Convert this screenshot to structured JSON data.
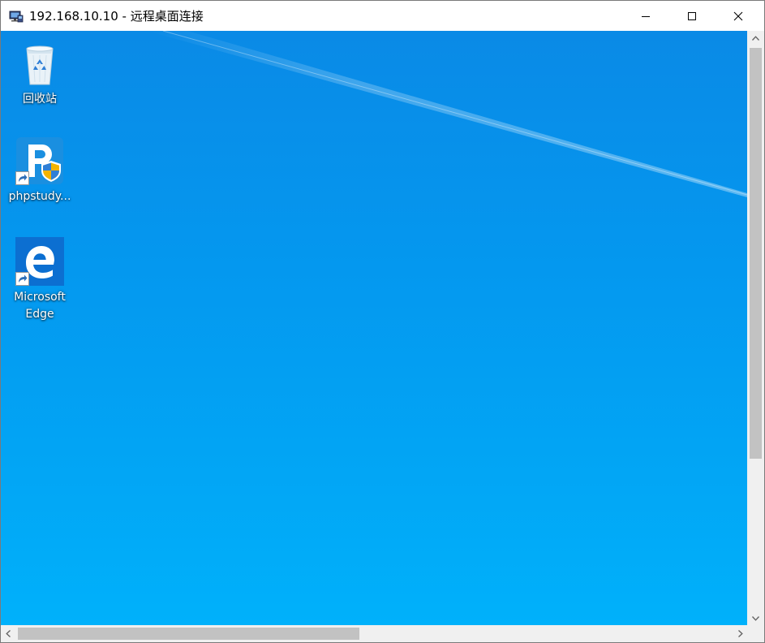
{
  "window": {
    "title": "192.168.10.10 - 远程桌面连接",
    "app_icon": "remote-desktop-icon",
    "controls": {
      "minimize": "minimize-icon",
      "maximize": "maximize-icon",
      "close": "close-icon"
    }
  },
  "desktop": {
    "background_colors": [
      "#0a8ae6",
      "#00b1fb"
    ],
    "icons": [
      {
        "label": "回收站",
        "icon": "recycle-bin-icon",
        "shortcut": false
      },
      {
        "label": "phpstudy...",
        "icon": "phpstudy-icon",
        "shortcut": true
      },
      {
        "label_lines": [
          "Microsoft",
          "Edge"
        ],
        "icon": "microsoft-edge-icon",
        "shortcut": true
      }
    ]
  },
  "scrollbars": {
    "vertical": {
      "up": "chevron-up-icon",
      "down": "chevron-down-icon"
    },
    "horizontal": {
      "left": "chevron-left-icon",
      "right": "chevron-right-icon"
    }
  }
}
